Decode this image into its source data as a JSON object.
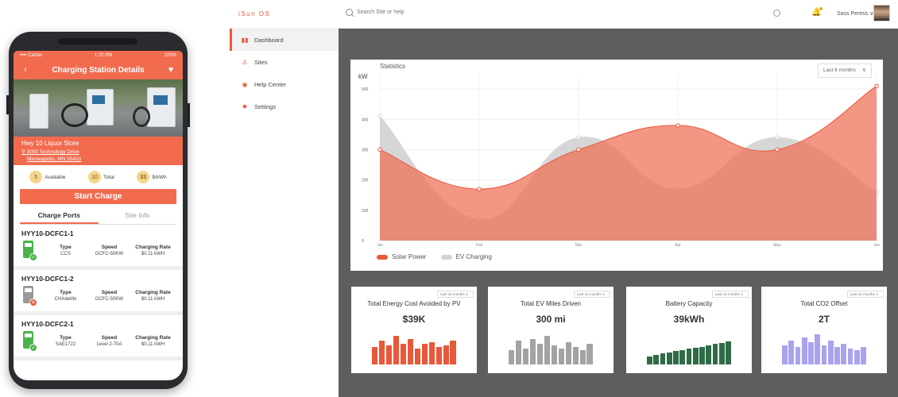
{
  "phone": {
    "status": {
      "carrier": "•••• Carrier",
      "time": "1:20 PM",
      "battery": "100%"
    },
    "appbar": {
      "title": "Charging Station Details",
      "back_icon": "back-arrow-icon",
      "fav_icon": "heart-icon"
    },
    "station": {
      "name": "Hwy 10 Liquor Store",
      "address_line1": "3000 Technology Drive",
      "address_line2": "Minneapolis, MN 55410"
    },
    "stats": [
      {
        "value": "5",
        "label": "Available"
      },
      {
        "value": "10",
        "label": "Total"
      },
      {
        "value": "$$",
        "label": "$/kWh"
      }
    ],
    "start_label": "Start Charge",
    "tabs": [
      "Charge Ports",
      "Site Info"
    ],
    "ports": [
      {
        "name": "HYY10-DCFC1-1",
        "type_label": "Type",
        "type": "CCS",
        "speed_label": "Speed",
        "speed": "DCFC-50KW",
        "rate_label": "Charging Rate",
        "rate": "$0.11 kWH",
        "status": "available",
        "color": "#49b34a"
      },
      {
        "name": "HYY10-DCFC1-2",
        "type_label": "Type",
        "type": "CHAdeMo",
        "speed_label": "Speed",
        "speed": "DCFC-50KW",
        "rate_label": "Charging Rate",
        "rate": "$0.11 kWH",
        "status": "unavailable",
        "color": "#9a9a9a"
      },
      {
        "name": "HYY10-DCFC2-1",
        "type_label": "Type",
        "type": "SAE1722",
        "speed_label": "Speed",
        "speed": "Level 2-70A",
        "rate_label": "Charging Rate",
        "rate": "$0.11 kWH",
        "status": "available",
        "color": "#49b34a"
      }
    ]
  },
  "web": {
    "logo": "iSun OS",
    "search_placeholder": "Search Site or help",
    "user_name": "Sass Peress ∨",
    "nav": [
      {
        "label": "Dashboard",
        "icon": "bar-chart-icon",
        "active": true
      },
      {
        "label": "Sites",
        "icon": "person-icon",
        "active": false
      },
      {
        "label": "Help Center",
        "icon": "globe-icon",
        "active": false
      },
      {
        "label": "Settings",
        "icon": "gear-icon",
        "active": false
      }
    ],
    "statistics": {
      "title": "Statistics",
      "unit": "kW",
      "range": "Last 6 months"
    },
    "kpis": [
      {
        "title": "Total Energy Cost Avoided by PV",
        "value": "$39K",
        "range": "Last 12 months",
        "color": "#e8583a",
        "bars": [
          0.55,
          0.75,
          0.6,
          0.9,
          0.65,
          0.8,
          0.5,
          0.65,
          0.7,
          0.55,
          0.6,
          0.75
        ]
      },
      {
        "title": "Total EV Miles Driven",
        "value": "300 mi",
        "range": "Last 12 months",
        "color": "#a3a3a3",
        "bars": [
          0.45,
          0.75,
          0.5,
          0.8,
          0.65,
          0.9,
          0.6,
          0.5,
          0.7,
          0.55,
          0.45,
          0.65
        ]
      },
      {
        "title": "Battery Capacity",
        "value": "39kWh",
        "range": "Last 12 months",
        "color": "#2f6b47",
        "bars": [
          0.25,
          0.3,
          0.35,
          0.38,
          0.42,
          0.46,
          0.5,
          0.53,
          0.56,
          0.6,
          0.64,
          0.68,
          0.72
        ]
      },
      {
        "title": "Total CO2 Offset",
        "value": "2T",
        "range": "Last 12 months",
        "color": "#a9a3ee",
        "bars": [
          0.6,
          0.75,
          0.55,
          0.85,
          0.7,
          0.95,
          0.6,
          0.75,
          0.55,
          0.65,
          0.5,
          0.45,
          0.55
        ]
      }
    ]
  },
  "chart_data": {
    "type": "area",
    "title": "Statistics",
    "ylabel": "kW",
    "categories": [
      "Jan",
      "Feb",
      "Mar",
      "Apr",
      "May",
      "Jun"
    ],
    "y_ticks": [
      0,
      100,
      200,
      300,
      400,
      500
    ],
    "ylim": [
      0,
      550
    ],
    "series": [
      {
        "name": "Solar Power",
        "color": "#f26b4f",
        "values": [
          300,
          170,
          300,
          380,
          300,
          510
        ]
      },
      {
        "name": "EV Charging",
        "color": "#cfcfcf",
        "values": [
          410,
          70,
          340,
          170,
          340,
          160
        ]
      }
    ],
    "legend_position": "bottom-left"
  }
}
